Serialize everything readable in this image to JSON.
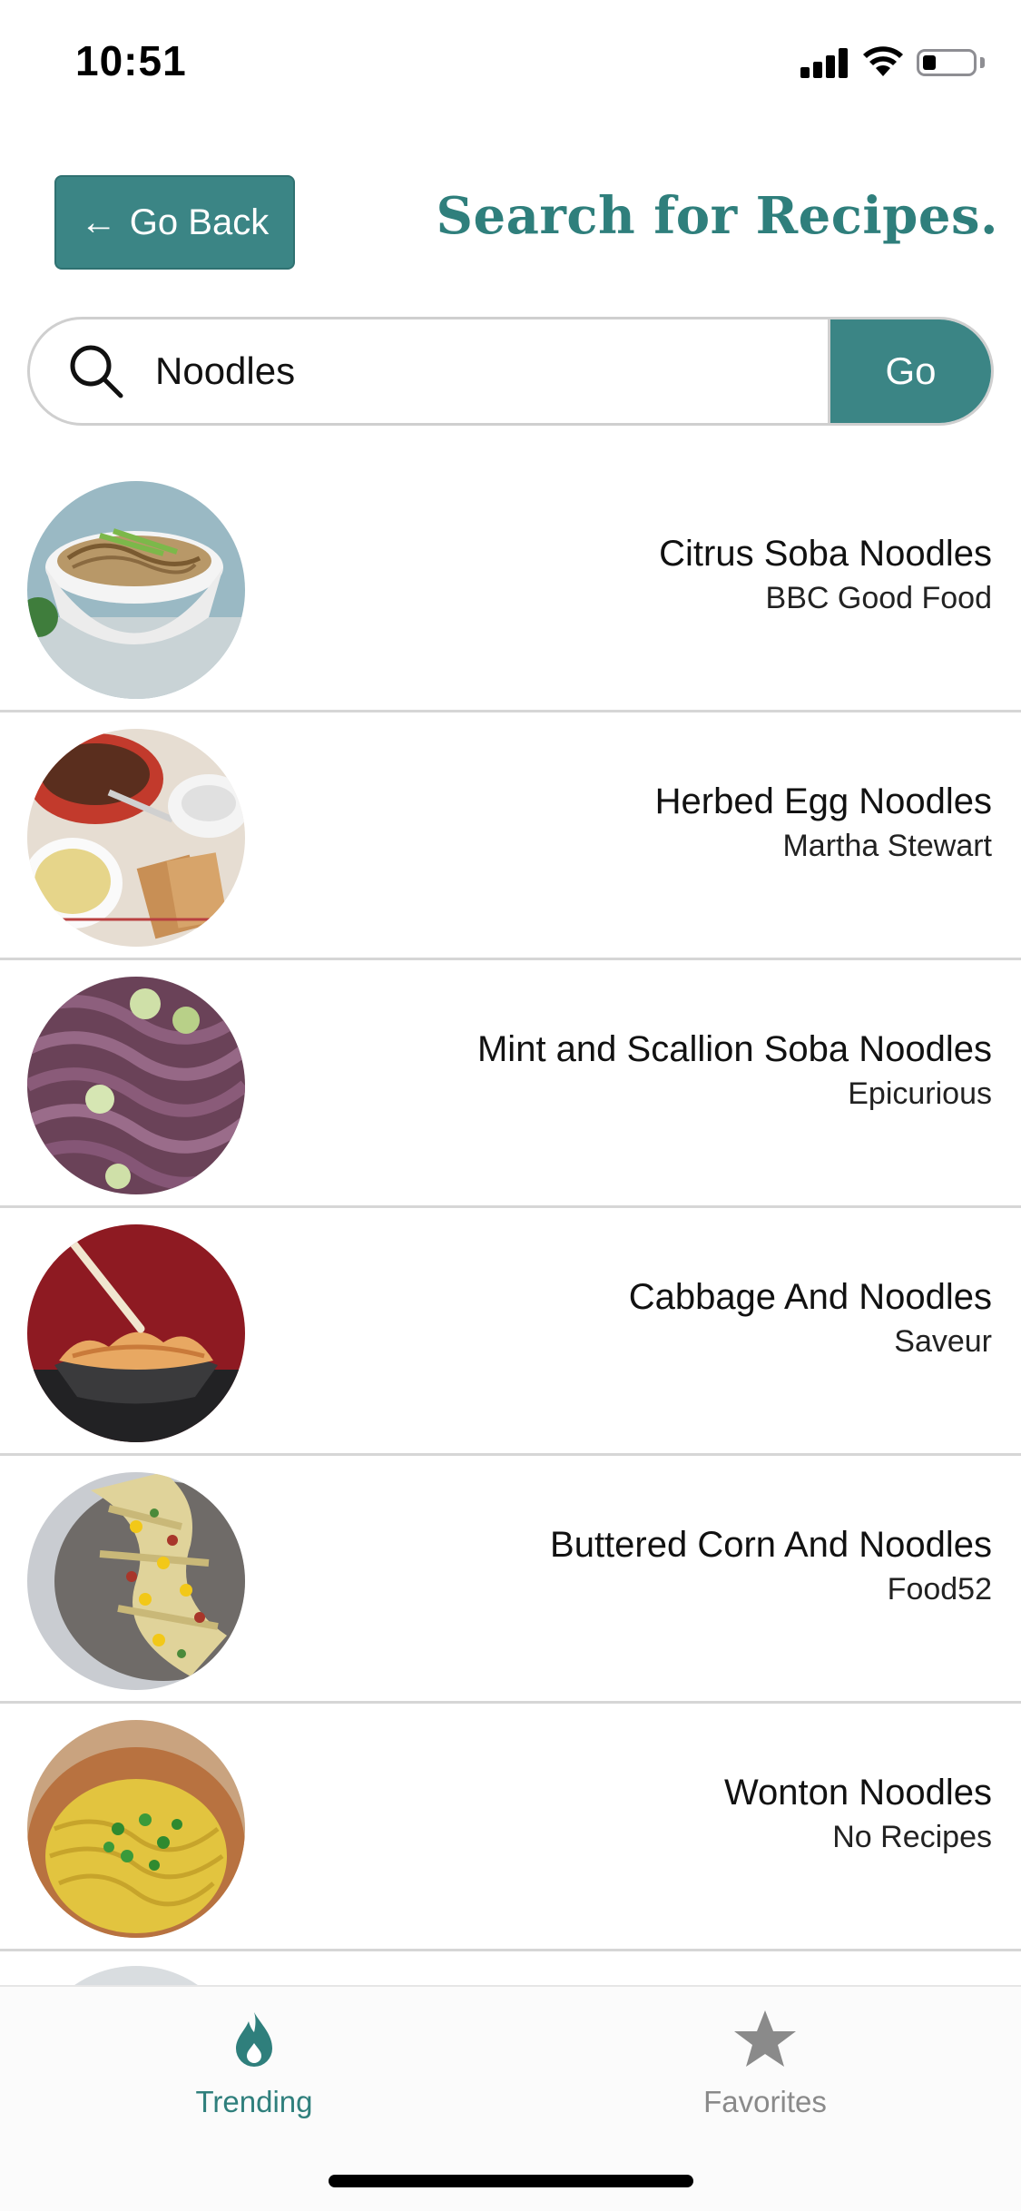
{
  "status_bar": {
    "time": "10:51"
  },
  "header": {
    "back_button_arrow": "←",
    "back_button_label": "Go Back",
    "title": "Search for Recipes."
  },
  "search": {
    "value": "Noodles",
    "go_label": "Go"
  },
  "results": [
    {
      "title": "Citrus Soba Noodles",
      "source": "BBC Good Food"
    },
    {
      "title": "Herbed Egg Noodles",
      "source": "Martha Stewart"
    },
    {
      "title": "Mint and Scallion Soba Noodles",
      "source": "Epicurious"
    },
    {
      "title": "Cabbage And Noodles",
      "source": "Saveur"
    },
    {
      "title": "Buttered Corn And Noodles",
      "source": "Food52"
    },
    {
      "title": "Wonton Noodles",
      "source": "No Recipes"
    }
  ],
  "tabs": [
    {
      "label": "Trending",
      "icon": "flame-icon",
      "active": true
    },
    {
      "label": "Favorites",
      "icon": "star-icon",
      "active": false
    }
  ],
  "colors": {
    "accent": "#3b8585",
    "title": "#2f7f7c",
    "inactive_tab": "#8a8a8a"
  }
}
